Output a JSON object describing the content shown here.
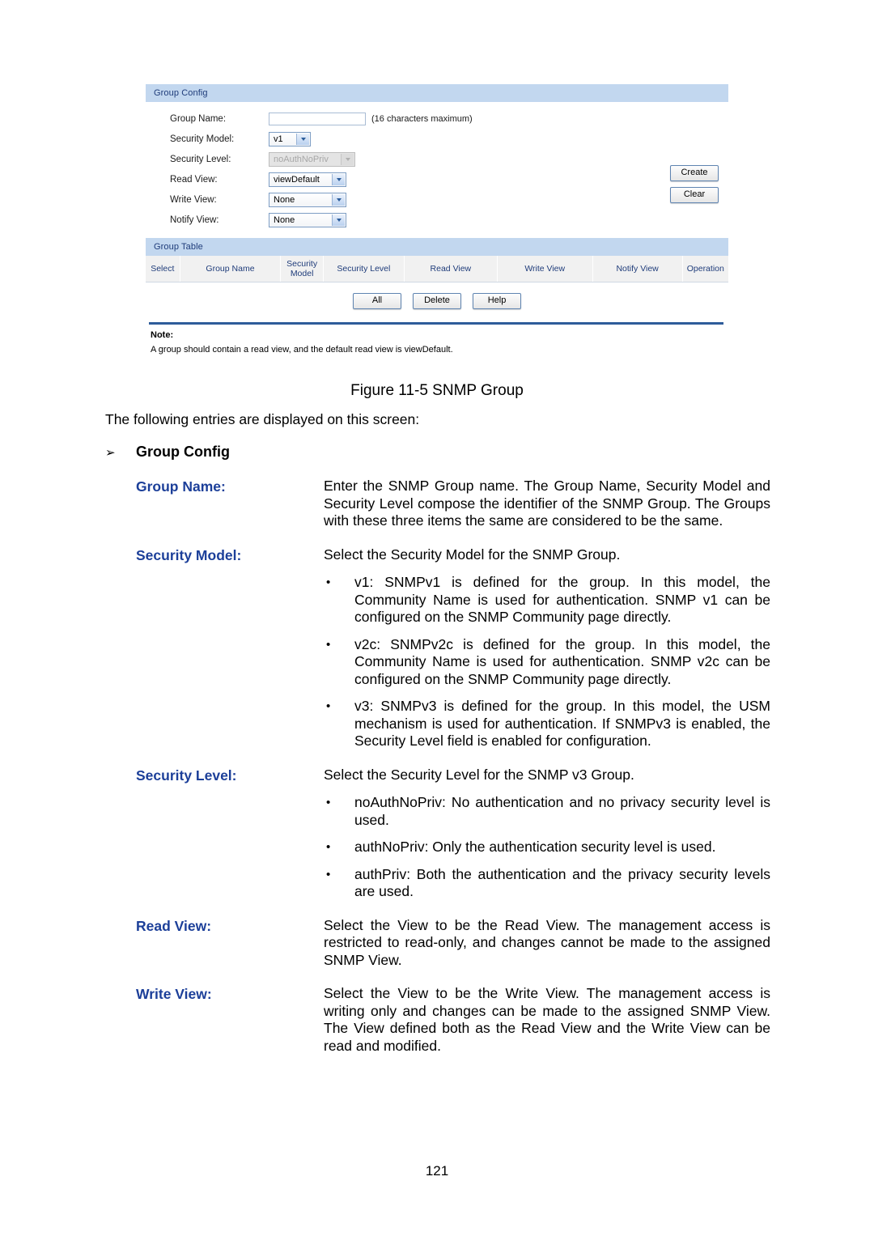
{
  "figure": {
    "group_config": {
      "panel_title": "Group Config",
      "fields": [
        {
          "label": "Group Name:",
          "type": "text",
          "value": "",
          "hint": "(16 characters maximum)"
        },
        {
          "label": "Security Model:",
          "type": "select",
          "value": "v1"
        },
        {
          "label": "Security Level:",
          "type": "select",
          "value": "noAuthNoPriv",
          "disabled": true
        },
        {
          "label": "Read View:",
          "type": "select",
          "value": "viewDefault"
        },
        {
          "label": "Write View:",
          "type": "select",
          "value": "None"
        },
        {
          "label": "Notify View:",
          "type": "select",
          "value": "None"
        }
      ],
      "buttons": [
        {
          "label": "Create"
        },
        {
          "label": "Clear"
        }
      ]
    },
    "group_table": {
      "panel_title": "Group Table",
      "columns": [
        "Select",
        "Group Name",
        "Security Model",
        "Security Level",
        "Read View",
        "Write View",
        "Notify View",
        "Operation"
      ],
      "rows": [],
      "buttons": [
        {
          "label": "All"
        },
        {
          "label": "Delete"
        },
        {
          "label": "Help"
        }
      ]
    },
    "note": {
      "title": "Note:",
      "text": "A group should contain a read view, and the default read view is viewDefault."
    },
    "colors": {
      "panel_header_bg": "#c2d7ef",
      "panel_header_text": "#1f3c7a",
      "table_header_bg": "#f1f1f1",
      "note_rule": "#2e5c9a"
    }
  },
  "caption": "Figure 11-5 SNMP Group",
  "doc": {
    "lead": "The following entries are displayed on this screen:",
    "section_marker": "➢",
    "section_title": "Group Config",
    "entries": [
      {
        "term": "Group Name:",
        "paragraphs": [
          "Enter the SNMP Group name. The Group Name, Security Model and Security Level compose the identifier of the SNMP Group. The Groups with these three items the same are considered to be the same."
        ],
        "bullets": []
      },
      {
        "term": "Security Model:",
        "paragraphs": [
          "Select the Security Model for the SNMP Group."
        ],
        "bullets": [
          "v1: SNMPv1 is defined for the group. In this model, the Community Name is used for authentication. SNMP v1 can be configured on the SNMP Community page directly.",
          "v2c: SNMPv2c is defined for the group. In this model, the Community Name is used for authentication. SNMP v2c can be configured on the SNMP Community page directly.",
          "v3: SNMPv3 is defined for the group. In this model, the USM mechanism is used for authentication. If SNMPv3 is enabled, the Security Level field is enabled for configuration."
        ]
      },
      {
        "term": "Security Level:",
        "paragraphs": [
          "Select the Security Level for the SNMP v3 Group."
        ],
        "bullets": [
          "noAuthNoPriv: No authentication and no privacy security level is used.",
          "authNoPriv: Only the authentication security level is used.",
          "authPriv: Both the authentication and the privacy security levels are used."
        ]
      },
      {
        "term": "Read View:",
        "paragraphs": [
          "Select the View to be the Read View. The management access is restricted to read-only, and changes cannot be made to the assigned SNMP View."
        ],
        "bullets": []
      },
      {
        "term": "Write View:",
        "paragraphs": [
          "Select the View to be the Write View. The management access is writing only and changes can be made to the assigned SNMP View. The View defined both as the Read View and the Write View can be read and modified."
        ],
        "bullets": []
      }
    ],
    "bullet_glyph": "•"
  },
  "page_number": "121"
}
